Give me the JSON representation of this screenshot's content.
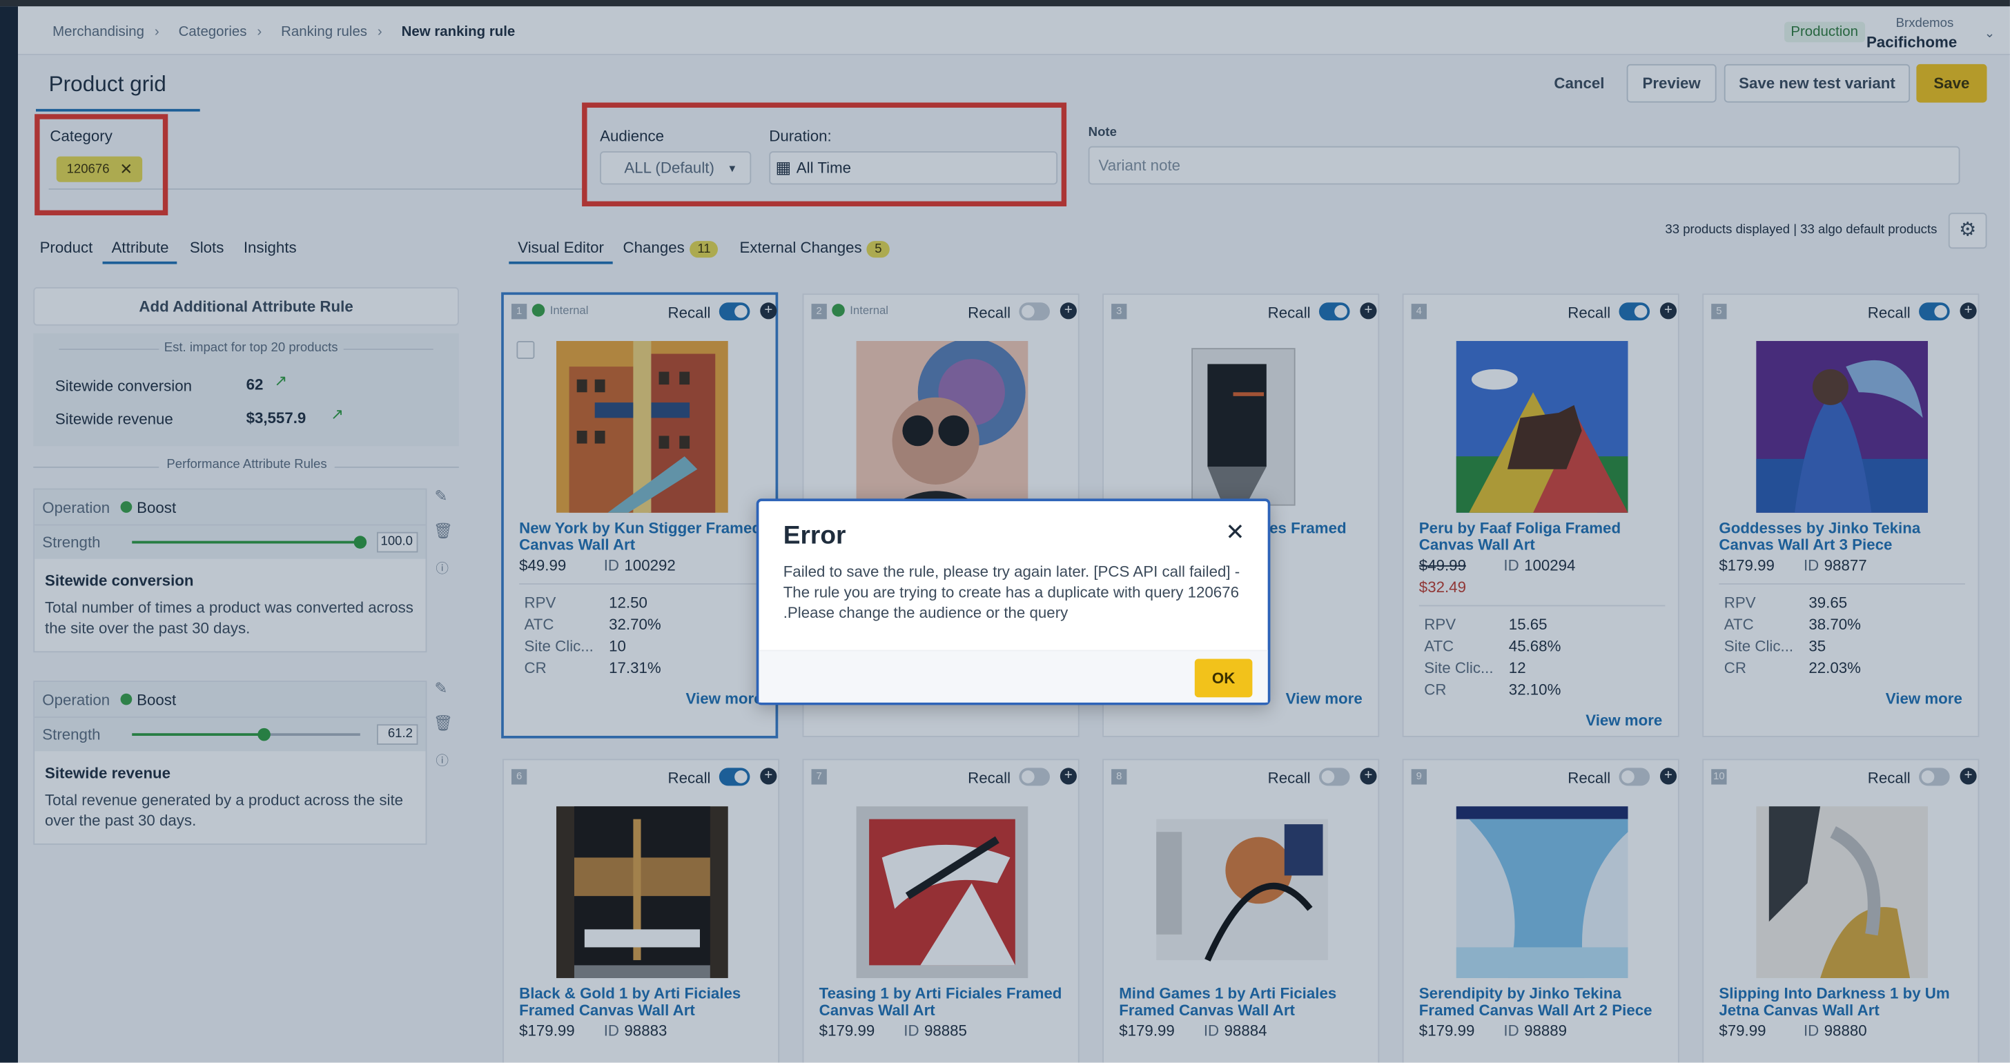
{
  "breadcrumb": [
    "Merchandising",
    "Categories",
    "Ranking rules",
    "New ranking rule"
  ],
  "account": {
    "environment": "Production",
    "org": "Brxdemos",
    "site": "Pacifichome"
  },
  "page": {
    "title": "Product grid",
    "buttons": {
      "cancel": "Cancel",
      "preview": "Preview",
      "save_test": "Save new test variant",
      "save": "Save"
    }
  },
  "filters": {
    "category_label": "Category",
    "category_chip": "120676",
    "audience_label": "Audience",
    "audience_value": "ALL (Default)",
    "duration_label": "Duration:",
    "duration_value": "All Time",
    "note_label": "Note",
    "note_placeholder": "Variant note"
  },
  "left_tabs": [
    "Product",
    "Attribute",
    "Slots",
    "Insights"
  ],
  "editor_tabs": {
    "visual": "Visual Editor",
    "changes": "Changes",
    "changes_count": "11",
    "external": "External Changes",
    "external_count": "5"
  },
  "summary": "33 products displayed | 33 algo default products",
  "sidebar": {
    "add_rule": "Add Additional Attribute Rule",
    "impact_title": "Est. impact for top 20 products",
    "conversion_label": "Sitewide conversion",
    "conversion_value": "62",
    "revenue_label": "Sitewide revenue",
    "revenue_value": "$3,557.9",
    "perf_title": "Performance Attribute Rules",
    "rules": [
      {
        "op_label": "Operation",
        "op": "Boost",
        "strength_label": "Strength",
        "strength": "100.0",
        "strength_frac": 1.0,
        "name": "Sitewide conversion",
        "desc": "Total number of times a product was converted across the site over the past 30 days."
      },
      {
        "op_label": "Operation",
        "op": "Boost",
        "strength_label": "Strength",
        "strength": "61.2",
        "strength_frac": 0.58,
        "name": "Sitewide revenue",
        "desc": "Total revenue generated by a product across the site over the past 30 days."
      }
    ]
  },
  "labels": {
    "recall": "Recall",
    "internal": "Internal",
    "id": "ID",
    "view_more": "View more",
    "rpv": "RPV",
    "atc": "ATC",
    "site_clicks": "Site Clic...",
    "cr": "CR"
  },
  "products": [
    {
      "rank": "1",
      "internal": true,
      "recall": true,
      "name": "New York by Kun Stigger Framed Canvas Wall Art",
      "price": "$49.99",
      "id": "100292",
      "rpv": "12.50",
      "atc": "32.70%",
      "clicks": "10",
      "cr": "17.31%"
    },
    {
      "rank": "2",
      "internal": true,
      "recall": false,
      "name": "",
      "price": "",
      "id": "",
      "rpv": "",
      "atc": "",
      "clicks": "",
      "cr": ""
    },
    {
      "rank": "3",
      "internal": false,
      "recall": true,
      "name": "...les Framed",
      "price": "",
      "id": "",
      "rpv": "",
      "atc": "",
      "clicks": "",
      "cr": ""
    },
    {
      "rank": "4",
      "internal": false,
      "recall": true,
      "name": "Peru by Faaf Foliga Framed Canvas Wall Art",
      "price": "$49.99",
      "sale": "$32.49",
      "id": "100294",
      "rpv": "15.65",
      "atc": "45.68%",
      "clicks": "12",
      "cr": "32.10%"
    },
    {
      "rank": "5",
      "internal": false,
      "recall": true,
      "name": "Goddesses by Jinko Tekina Canvas Wall Art 3 Piece",
      "price": "$179.99",
      "id": "98877",
      "rpv": "39.65",
      "atc": "38.70%",
      "clicks": "35",
      "cr": "22.03%"
    },
    {
      "rank": "6",
      "internal": false,
      "recall": true,
      "name": "Black & Gold 1 by Arti Ficiales Framed Canvas Wall Art",
      "price": "$179.99",
      "id": "98883"
    },
    {
      "rank": "7",
      "internal": false,
      "recall": false,
      "name": "Teasing 1 by Arti Ficiales Framed Canvas Wall Art",
      "price": "$179.99",
      "id": "98885"
    },
    {
      "rank": "8",
      "internal": false,
      "recall": false,
      "name": "Mind Games 1 by Arti Ficiales Framed Canvas Wall Art",
      "price": "$179.99",
      "id": "98884"
    },
    {
      "rank": "9",
      "internal": false,
      "recall": false,
      "name": "Serendipity by Jinko Tekina Framed Canvas Wall Art 2 Piece",
      "price": "$179.99",
      "id": "98889"
    },
    {
      "rank": "10",
      "internal": false,
      "recall": false,
      "name": "Slipping Into Darkness 1 by Um Jetna Canvas Wall Art",
      "price": "$79.99",
      "id": "98880"
    }
  ],
  "modal": {
    "title": "Error",
    "message": "Failed to save the rule, please try again later. [PCS API call failed] - The rule you are trying to create has a duplicate with query 120676 .Please change the audience or the query",
    "ok": "OK"
  },
  "colors": {
    "accent": "#1f6fb2",
    "primary_button": "#f2c21b",
    "highlight_box": "#e5372a",
    "boost": "#3aa046"
  }
}
